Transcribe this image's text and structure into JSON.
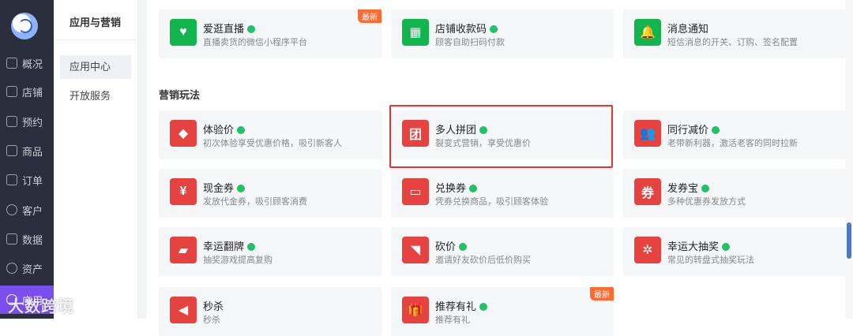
{
  "sidebar": {
    "items": [
      {
        "label": "概况"
      },
      {
        "label": "店铺"
      },
      {
        "label": "预约"
      },
      {
        "label": "商品"
      },
      {
        "label": "订单"
      },
      {
        "label": "客户"
      },
      {
        "label": "数据"
      },
      {
        "label": "资产"
      },
      {
        "label": "应用"
      }
    ]
  },
  "subnav": {
    "title": "应用与营销",
    "items": [
      {
        "label": "应用中心"
      },
      {
        "label": "开放服务"
      }
    ]
  },
  "top_cards": [
    {
      "name": "爱逛直播",
      "desc": "直播卖货的微信小程序平台",
      "badge": "最新"
    },
    {
      "name": "店铺收款码",
      "desc": "顾客自助扫码付款"
    },
    {
      "name": "消息通知",
      "desc": "短信消息的开关、订购、签名配置"
    }
  ],
  "section": {
    "title": "营销玩法"
  },
  "cards": [
    {
      "name": "体验价",
      "desc": "初次体验享受优惠价格，吸引新客人"
    },
    {
      "name": "多人拼团",
      "desc": "裂变式营销，享受优惠价"
    },
    {
      "name": "同行减价",
      "desc": "老带新利器，激活老客的同时拉新"
    },
    {
      "name": "现金券",
      "desc": "发放代金券，吸引顾客消费"
    },
    {
      "name": "兑换券",
      "desc": "凭券兑换商品，吸引顾客体验"
    },
    {
      "name": "发券宝",
      "desc": "多种优惠券发放方式"
    },
    {
      "name": "幸运翻牌",
      "desc": "抽奖游戏提高复购"
    },
    {
      "name": "砍价",
      "desc": "邀请好友砍价后低价购买"
    },
    {
      "name": "幸运大抽奖",
      "desc": "常见的转盘式抽奖玩法"
    },
    {
      "name": "秒杀",
      "desc": "秒杀"
    },
    {
      "name": "推荐有礼",
      "desc": "推荐有礼",
      "badge": "最新"
    }
  ],
  "watermark": "大数跨境"
}
